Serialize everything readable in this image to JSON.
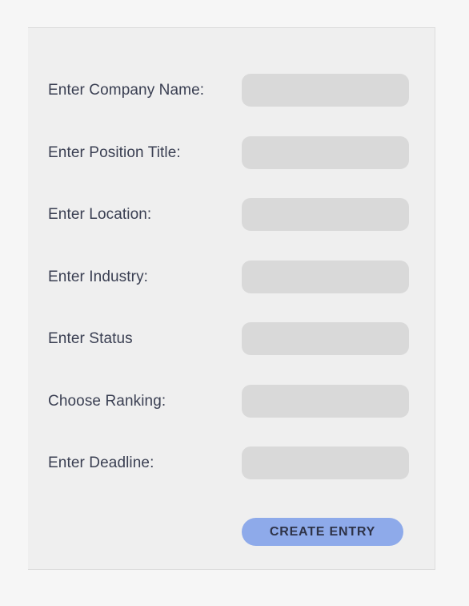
{
  "form": {
    "fields": [
      {
        "label": "Enter Company Name:",
        "value": ""
      },
      {
        "label": "Enter Position Title:",
        "value": ""
      },
      {
        "label": "Enter Location:",
        "value": ""
      },
      {
        "label": "Enter Industry:",
        "value": ""
      },
      {
        "label": "Enter Status",
        "value": ""
      },
      {
        "label": "Choose Ranking:",
        "value": ""
      },
      {
        "label": "Enter Deadline:",
        "value": ""
      }
    ],
    "submit_label": "CREATE ENTRY",
    "colors": {
      "button": "#8eaaea",
      "field": "#d9d9d9",
      "panel": "#efefef",
      "text": "#3a3f52"
    }
  }
}
